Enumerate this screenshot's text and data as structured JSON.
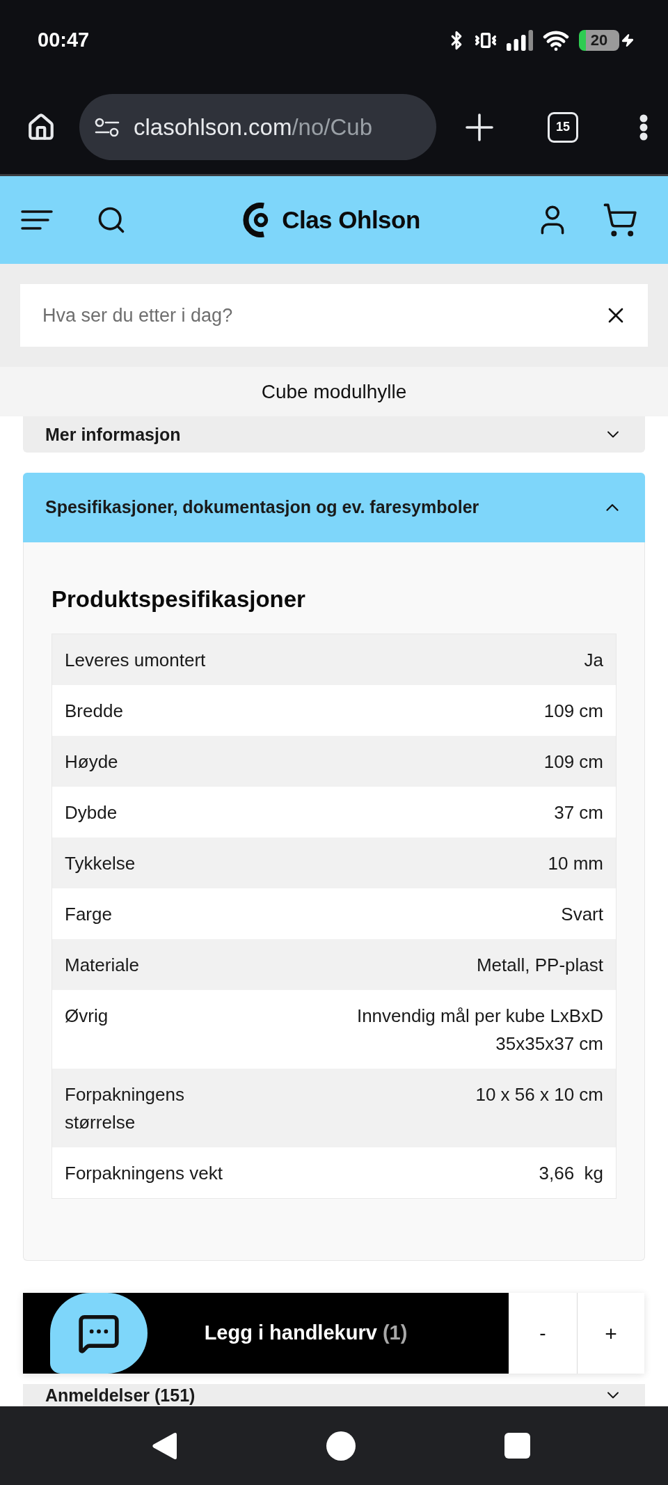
{
  "status_bar": {
    "time": "00:47",
    "battery": "20",
    "charging": true
  },
  "browser": {
    "url_host": "clasohlson.com",
    "url_path": "/no/Cub",
    "tab_count": "15"
  },
  "header": {
    "logo": "Clas Ohlson"
  },
  "search": {
    "placeholder": "Hva ser du etter i dag?"
  },
  "product_title": "Cube modulhylle",
  "sections": [
    {
      "label": "Mer informasjon",
      "expanded": false
    },
    {
      "label": "Spesifikasjoner, dokumentasjon og ev. faresymboler",
      "expanded": true,
      "content": {
        "title": "Produktspesifikasjoner",
        "rows": [
          {
            "label": "Leveres umontert",
            "value": "Ja"
          },
          {
            "label": "Bredde",
            "value": "109 cm"
          },
          {
            "label": "Høyde",
            "value": "109 cm"
          },
          {
            "label": "Dybde",
            "value": "37 cm"
          },
          {
            "label": "Tykkelse",
            "value": "10 mm"
          },
          {
            "label": "Farge",
            "value": "Svart"
          },
          {
            "label": "Materiale",
            "value": "Metall, PP-plast"
          },
          {
            "label": "Øvrig",
            "value": "Innvendig mål per kube LxBxD 35x35x37 cm"
          },
          {
            "label": "Forpakningens størrelse",
            "value": "10 x 56 x 10 cm"
          },
          {
            "label": "Forpakningens vekt",
            "value": "3,66  kg"
          }
        ]
      }
    },
    {
      "label": "Anmeldelser (151)",
      "expanded": false
    }
  ],
  "cart_bar": {
    "button": "Legg i handlekurv",
    "count": "(1)",
    "decrease": "-",
    "increase": "+"
  }
}
